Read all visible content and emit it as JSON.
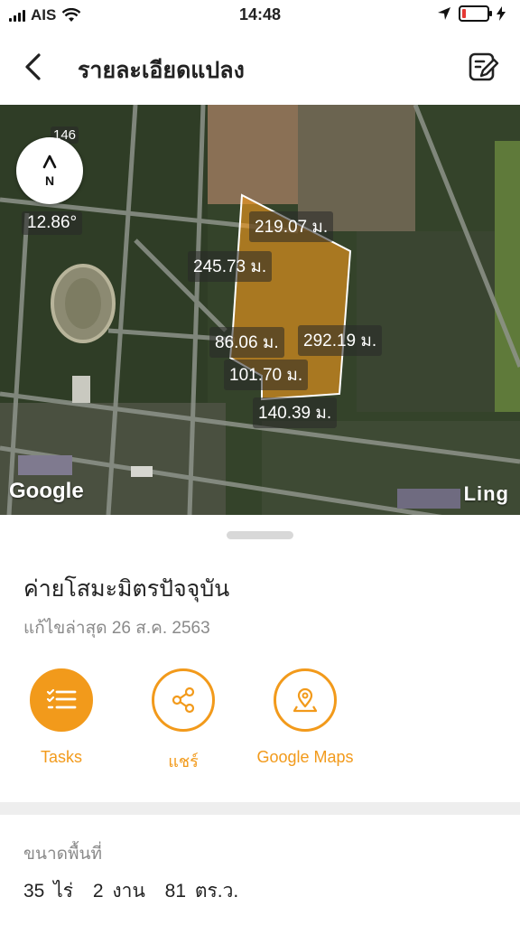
{
  "status_bar": {
    "carrier": "AIS",
    "time": "14:48",
    "battery_level": 0.15
  },
  "nav": {
    "title": "รายละเอียดแปลง",
    "back_icon": "chevron-left-icon",
    "edit_icon": "edit-note-icon"
  },
  "map": {
    "top_partial_label": "146",
    "rotation": "12.86°",
    "compass_letter": "N",
    "measurements": [
      "219.07 ม.",
      "245.73 ม.",
      "86.06 ม.",
      "292.19 ม.",
      "101.70 ม.",
      "140.39 ม."
    ],
    "google_logo": "Google",
    "watermark": "Ling",
    "plot_color": "#f29a1b"
  },
  "plot": {
    "name": "ค่ายโสมะมิตรปัจจุบัน",
    "last_edited": "แก้ไขล่าสุด 26 ส.ค. 2563"
  },
  "actions": [
    {
      "label": "Tasks",
      "icon": "task-list-icon"
    },
    {
      "label": "แชร์",
      "icon": "share-icon"
    },
    {
      "label": "Google Maps",
      "icon": "map-pin-icon"
    }
  ],
  "area": {
    "label": "ขนาดพื้นที่",
    "rai": "35 ไร่",
    "ngan": "2 งาน",
    "wah": "81 ตร.ว."
  },
  "accent_color": "#f29a1b"
}
